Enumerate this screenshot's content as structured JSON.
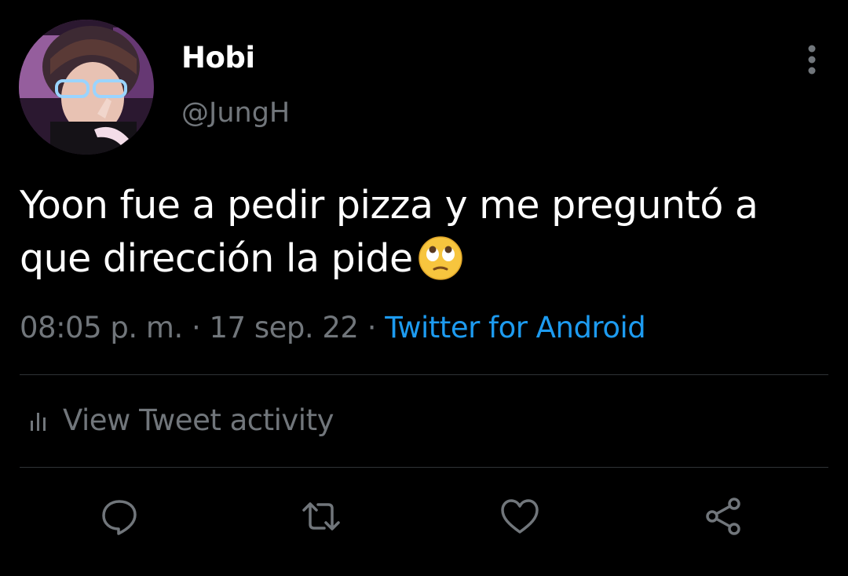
{
  "author": {
    "display_name": "Hobi",
    "handle": "@JungH"
  },
  "tweet": {
    "text": "Yoon fue a pedir pizza y me preguntó a que dirección la pide",
    "emoji": "face-with-rolling-eyes"
  },
  "meta": {
    "time": "08:05 p. m.",
    "separator": " · ",
    "date": "17 sep. 22",
    "source": "Twitter for Android"
  },
  "activity": {
    "label": "View Tweet activity"
  },
  "actions": {
    "icons": [
      "reply-icon",
      "retweet-icon",
      "like-icon",
      "share-icon"
    ]
  },
  "colors": {
    "background": "#000000",
    "primary_text": "#ffffff",
    "secondary_text": "#71767b",
    "link": "#1d9bf0",
    "divider": "#2f3336"
  }
}
